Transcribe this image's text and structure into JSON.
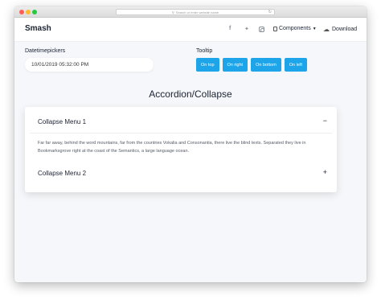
{
  "browser": {
    "url_placeholder": "Search or enter website name"
  },
  "navbar": {
    "brand": "Smash",
    "components_label": "Components",
    "download_label": "Download"
  },
  "datetime": {
    "label": "Datetimepickers",
    "value": "10/01/2019 05:32:00 PM"
  },
  "tooltip": {
    "label": "Tooltip",
    "buttons": [
      "On top",
      "On right",
      "On bottom",
      "On left"
    ]
  },
  "accordion": {
    "title": "Accordion/Collapse",
    "items": [
      {
        "label": "Collapse Menu 1",
        "toggle": "−",
        "body": "Far far away, behind the word mountains, far from the countries Vokalia and Consonantia, there live the blind texts. Separated they live in Bookmarksgrove right at the coast of the Semantics, a large language ocean."
      },
      {
        "label": "Collapse Menu 2",
        "toggle": "+"
      }
    ]
  },
  "icons": {
    "facebook": "facebook-icon",
    "twitter": "twitter-icon",
    "instagram": "instagram-icon",
    "components": "document-icon",
    "download": "cloud-download-icon"
  }
}
